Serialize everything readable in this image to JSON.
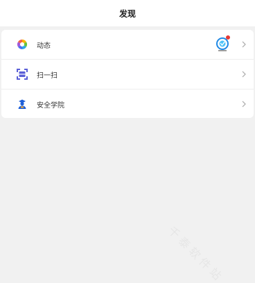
{
  "header": {
    "title": "发现"
  },
  "menu": {
    "items": [
      {
        "label": "动态",
        "icon": "moments-icon",
        "has_badge": true
      },
      {
        "label": "扫一扫",
        "icon": "scan-icon",
        "has_badge": false
      },
      {
        "label": "安全学院",
        "icon": "security-academy-icon",
        "has_badge": false
      }
    ]
  },
  "watermark": {
    "text": "千 泰 软 件 站"
  },
  "colors": {
    "accent": "#1e5fd8",
    "badge": "#e53935",
    "background": "#f1f1f1"
  }
}
